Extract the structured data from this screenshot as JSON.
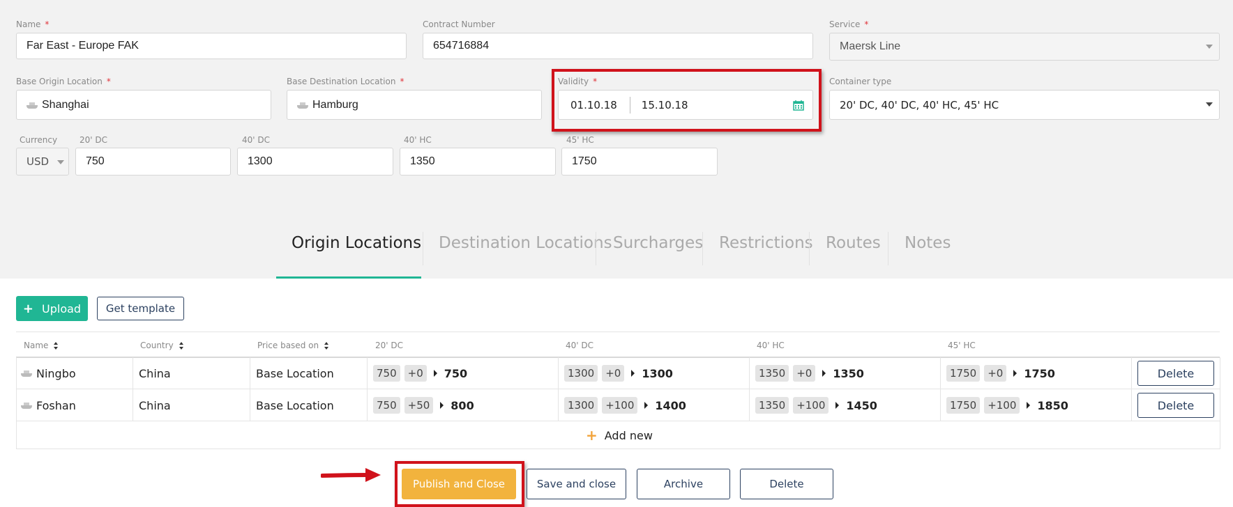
{
  "form": {
    "name": {
      "label": "Name",
      "required": "*",
      "value": "Far East - Europe FAK"
    },
    "contract_number": {
      "label": "Contract Number",
      "value": "654716884"
    },
    "service": {
      "label": "Service",
      "required": "*",
      "value": "Maersk Line"
    },
    "base_origin": {
      "label": "Base Origin Location",
      "required": "*",
      "value": "Shanghai"
    },
    "base_destination": {
      "label": "Base Destination Location",
      "required": "*",
      "value": "Hamburg"
    },
    "validity": {
      "label": "Validity",
      "required": "*",
      "from": "01.10.18",
      "to": "15.10.18"
    },
    "container_type": {
      "label": "Container type",
      "value": "20' DC, 40' DC, 40' HC, 45' HC"
    },
    "currency": {
      "label": "Currency",
      "value": "USD"
    },
    "rates": [
      {
        "label": "20' DC",
        "value": "750"
      },
      {
        "label": "40' DC",
        "value": "1300"
      },
      {
        "label": "40' HC",
        "value": "1350"
      },
      {
        "label": "45' HC",
        "value": "1750"
      }
    ]
  },
  "tabs": [
    {
      "label": "Origin Locations",
      "active": true
    },
    {
      "label": "Destination Locations"
    },
    {
      "label": "Surcharges"
    },
    {
      "label": "Restrictions"
    },
    {
      "label": "Routes"
    },
    {
      "label": "Notes"
    }
  ],
  "toolbar": {
    "upload_label": "Upload",
    "template_label": "Get template"
  },
  "table": {
    "headers": [
      "Name",
      "Country",
      "Price based on",
      "20' DC",
      "40' DC",
      "40' HC",
      "45' HC"
    ],
    "rows": [
      {
        "name": "Ningbo",
        "country": "China",
        "price_basis": "Base Location",
        "prices": [
          {
            "base": "750",
            "adj": "+0",
            "total": "750"
          },
          {
            "base": "1300",
            "adj": "+0",
            "total": "1300"
          },
          {
            "base": "1350",
            "adj": "+0",
            "total": "1350"
          },
          {
            "base": "1750",
            "adj": "+0",
            "total": "1750"
          }
        ],
        "delete_label": "Delete"
      },
      {
        "name": "Foshan",
        "country": "China",
        "price_basis": "Base Location",
        "prices": [
          {
            "base": "750",
            "adj": "+50",
            "total": "800"
          },
          {
            "base": "1300",
            "adj": "+100",
            "total": "1400"
          },
          {
            "base": "1350",
            "adj": "+100",
            "total": "1450"
          },
          {
            "base": "1750",
            "adj": "+100",
            "total": "1850"
          }
        ],
        "delete_label": "Delete"
      }
    ],
    "add_new_label": "Add new"
  },
  "footer": {
    "publish_label": "Publish and Close",
    "save_label": "Save and close",
    "archive_label": "Archive",
    "delete_label": "Delete"
  },
  "colors": {
    "accent": "#20b694",
    "primary_dark": "#2c4160",
    "publish": "#f2b33d",
    "highlight": "#d0121b",
    "add_plus": "#f2a33a"
  }
}
